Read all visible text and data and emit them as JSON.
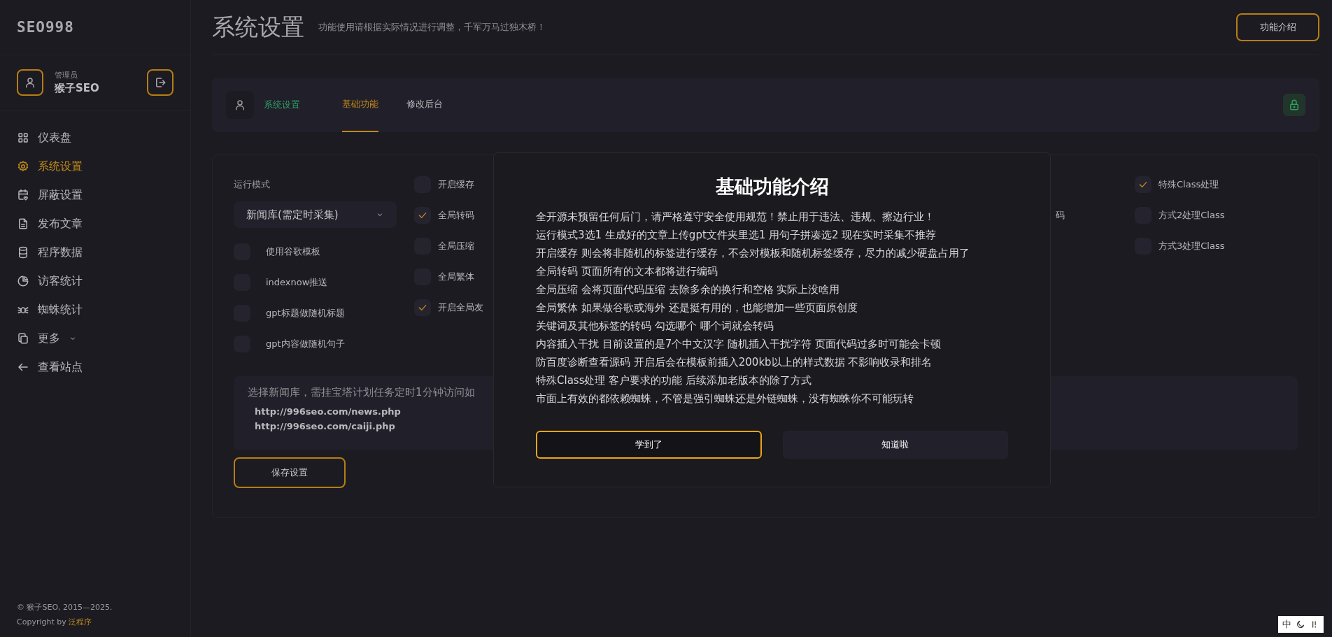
{
  "sidebar": {
    "logo": "SEO998",
    "user": {
      "role": "管理员",
      "name": "猴子SEO"
    },
    "items": [
      {
        "label": "仪表盘",
        "selected": false,
        "collapsible": false
      },
      {
        "label": "系统设置",
        "selected": true,
        "collapsible": false
      },
      {
        "label": "屏蔽设置",
        "selected": false,
        "collapsible": false
      },
      {
        "label": "发布文章",
        "selected": false,
        "collapsible": false
      },
      {
        "label": "程序数据",
        "selected": false,
        "collapsible": false
      },
      {
        "label": "访客统计",
        "selected": false,
        "collapsible": false
      },
      {
        "label": "蜘蛛统计",
        "selected": false,
        "collapsible": false
      },
      {
        "label": "更多",
        "selected": false,
        "collapsible": true
      },
      {
        "label": "查看站点",
        "selected": false,
        "collapsible": false
      }
    ],
    "footer": {
      "copyright": "© 猴子SEO, 2015—2025.",
      "credit_prefix": "Copyright by",
      "credit_link": "泛程序"
    }
  },
  "header": {
    "title": "系统设置",
    "subtitle": "功能使用请根据实际情况进行调整，千军万马过独木桥！",
    "button": "功能介绍"
  },
  "tabbar": {
    "section": "系统设置",
    "tabs": [
      {
        "label": "基础功能",
        "selected": true
      },
      {
        "label": "修改后台",
        "selected": false
      }
    ]
  },
  "form": {
    "run_mode": {
      "label": "运行模式",
      "value": "新闻库(需定时采集)"
    },
    "column_1": [
      {
        "label": "使用谷歌模板",
        "checked": false
      },
      {
        "label": "indexnow推送",
        "checked": false
      },
      {
        "label": "gpt标题做随机标题",
        "checked": false
      },
      {
        "label": "gpt内容做随机句子",
        "checked": false
      }
    ],
    "column_2": [
      {
        "label": "开启缓存",
        "checked": false
      },
      {
        "label": "全局转码",
        "checked": true
      },
      {
        "label": "全局压缩",
        "checked": false
      },
      {
        "label": "全局繁体",
        "checked": false
      },
      {
        "label": "开启全局友",
        "checked": true
      }
    ],
    "column_3": [
      "码"
    ],
    "column_4": [
      {
        "label": "特殊Class处理",
        "checked": true
      },
      {
        "label": "方式2处理Class",
        "checked": false
      },
      {
        "label": "方式3处理Class",
        "checked": false
      }
    ],
    "info": {
      "text": "选择新闻库，需挂宝塔计划任务定时1分钟访问如",
      "urls": [
        "http://996seo.com/news.php",
        "http://996seo.com/caiji.php"
      ]
    },
    "save_button": "保存设置"
  },
  "modal": {
    "title": "基础功能介绍",
    "lines": [
      "全开源未预留任何后门，请严格遵守安全使用规范！禁止用于违法、违规、擦边行业！",
      "运行模式3选1 生成好的文章上传gpt文件夹里选1 用句子拼凑选2 现在实时采集不推荐",
      "开启缓存 则会将非随机的标签进行缓存，不会对模板和随机标签缓存，尽力的减少硬盘占用了",
      "全局转码 页面所有的文本都将进行编码",
      "全局压缩 会将页面代码压缩 去除多余的换行和空格 实际上没啥用",
      "全局繁体 如果做谷歌或海外 还是挺有用的，也能增加一些页面原创度",
      "关键词及其他标签的转码 勾选哪个 哪个词就会转码",
      "内容插入干扰 目前设置的是7个中文汉字 随机插入干扰字符 页面代码过多时可能会卡顿",
      "防百度诊断查看源码 开启后会在模板前插入200kb以上的样式数据 不影响收录和排名",
      "特殊Class处理 客户要求的功能 后续添加老版本的除了方式",
      "市面上有效的都依赖蜘蛛，不管是强引蜘蛛还是外链蜘蛛，没有蜘蛛你不可能玩转"
    ],
    "buttons": [
      {
        "label": "学到了",
        "kind": "primary"
      },
      {
        "label": "知道啦",
        "kind": "secondary"
      }
    ]
  },
  "ime": {
    "label": "中"
  }
}
